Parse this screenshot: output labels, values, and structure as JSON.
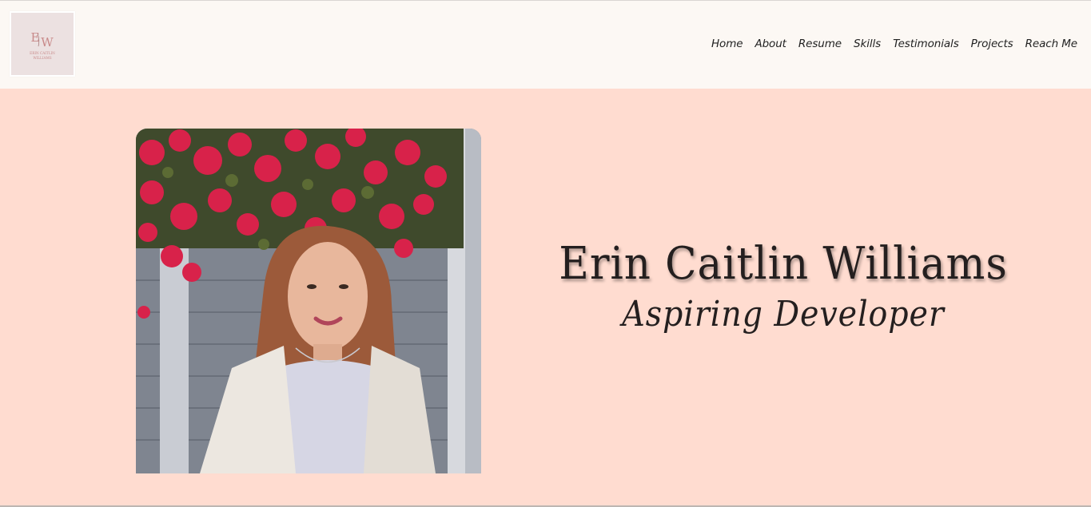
{
  "header": {
    "logo": {
      "monogram": "EW",
      "name_line1": "ERIN CAITLIN",
      "name_line2": "WILLIAMS"
    },
    "nav": [
      {
        "label": "Home"
      },
      {
        "label": "About"
      },
      {
        "label": "Resume"
      },
      {
        "label": "Skills"
      },
      {
        "label": "Testimonials"
      },
      {
        "label": "Projects"
      },
      {
        "label": "Reach Me"
      }
    ]
  },
  "hero": {
    "name": "Erin Caitlin Williams",
    "role": "Aspiring Developer"
  },
  "colors": {
    "header_bg": "#fcf8f4",
    "hero_bg": "#ffdcd0",
    "text": "#241f1f",
    "logo_bg": "#ece1e1",
    "logo_accent": "#c98a8a"
  }
}
